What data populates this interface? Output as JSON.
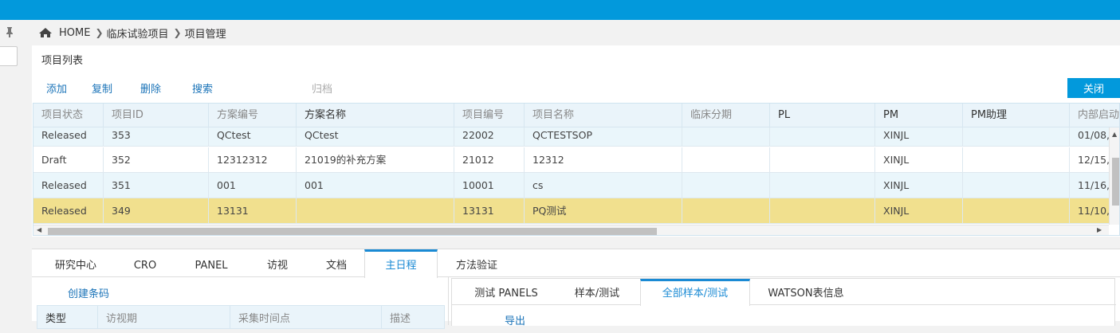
{
  "breadcrumb": {
    "home": "HOME",
    "level1": "临床试验项目",
    "level2": "项目管理"
  },
  "panel": {
    "title": "项目列表"
  },
  "toolbar": {
    "add": "添加",
    "copy": "复制",
    "delete": "删除",
    "search": "搜索",
    "archive": "归档",
    "close": "关闭"
  },
  "grid": {
    "columns": [
      "项目状态",
      "项目ID",
      "方案编号",
      "方案名称",
      "项目编号",
      "项目名称",
      "临床分期",
      "PL",
      "PM",
      "PM助理",
      "内部启动"
    ],
    "rows": [
      {
        "status": "Released",
        "id": "353",
        "protocol_no": "QCtest",
        "protocol_name": "QCtest",
        "project_no": "22002",
        "project_name": "QCTESTSOP",
        "phase": "",
        "pl": "",
        "pm": "XINJL",
        "pm_assistant": "",
        "start": "01/08,"
      },
      {
        "status": "Draft",
        "id": "352",
        "protocol_no": "12312312",
        "protocol_name": "21019的补充方案",
        "project_no": "21012",
        "project_name": "12312",
        "phase": "",
        "pl": "",
        "pm": "XINJL",
        "pm_assistant": "",
        "start": "12/15,"
      },
      {
        "status": "Released",
        "id": "351",
        "protocol_no": "001",
        "protocol_name": "001",
        "project_no": "10001",
        "project_name": "cs",
        "phase": "",
        "pl": "",
        "pm": "XINJL",
        "pm_assistant": "",
        "start": "11/16,"
      },
      {
        "status": "Released",
        "id": "349",
        "protocol_no": "13131",
        "protocol_name": "",
        "project_no": "13131",
        "project_name": "PQ测试",
        "phase": "",
        "pl": "",
        "pm": "XINJL",
        "pm_assistant": "",
        "start": "11/10,"
      }
    ]
  },
  "bottom_tabs": [
    "研究中心",
    "CRO",
    "PANEL",
    "访视",
    "文档",
    "主日程",
    "方法验证"
  ],
  "active_bottom_tab": "主日程",
  "create_link": "创建条码",
  "subgrid": {
    "columns": [
      "类型",
      "访视期",
      "采集时间点",
      "描述"
    ]
  },
  "right_tabs": [
    "测试 PANELS",
    "样本/测试",
    "全部样本/测试",
    "WATSON表信息"
  ],
  "active_right_tab": "全部样本/测试",
  "export_link": "导出"
}
